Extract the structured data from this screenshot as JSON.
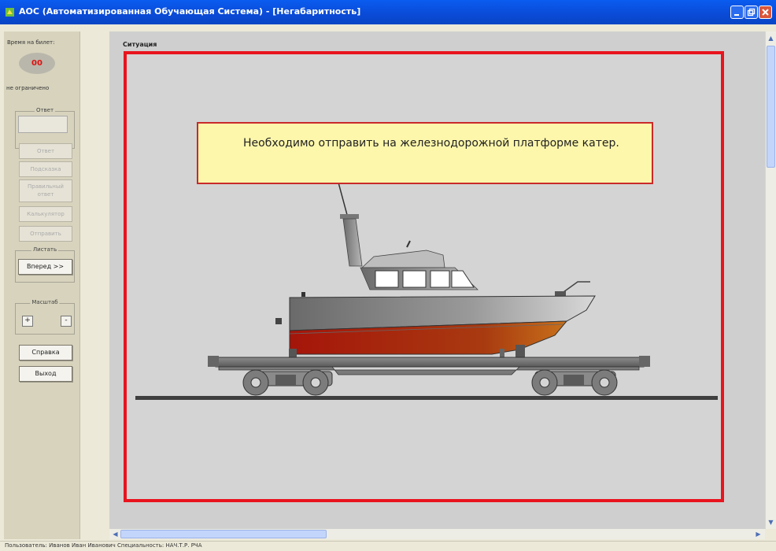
{
  "window": {
    "title": "AOC (Автоматизированная Обучающая Система) - [Негабаритность]"
  },
  "left_panel": {
    "time_label": "Время на билет:",
    "timer_value": "00",
    "time_limit": "не ограничено",
    "answer_group": "Ответ",
    "buttons": {
      "answer": "Ответ",
      "hint": "Подсказка",
      "correct_answer": "Правильный ответ",
      "calculator": "Калькулятор",
      "send": "Отправить"
    },
    "page_group": "Листать",
    "forward": "Вперед >>",
    "scale_group": "Масштаб",
    "zoom_in": "+",
    "zoom_out": "-",
    "help": "Справка",
    "exit": "Выход"
  },
  "main": {
    "section_label": "Ситуация",
    "callout_text": "Необходимо отправить на железнодорожной платформе катер."
  },
  "status": {
    "text": "Пользователь: Иванов Иван Иванович   Специальность: НАЧ.Т.Р. РЧА"
  },
  "colors": {
    "frame": "#e8141e",
    "callout_bg": "#fdf7ac",
    "hull_red": "#b31a0c"
  }
}
